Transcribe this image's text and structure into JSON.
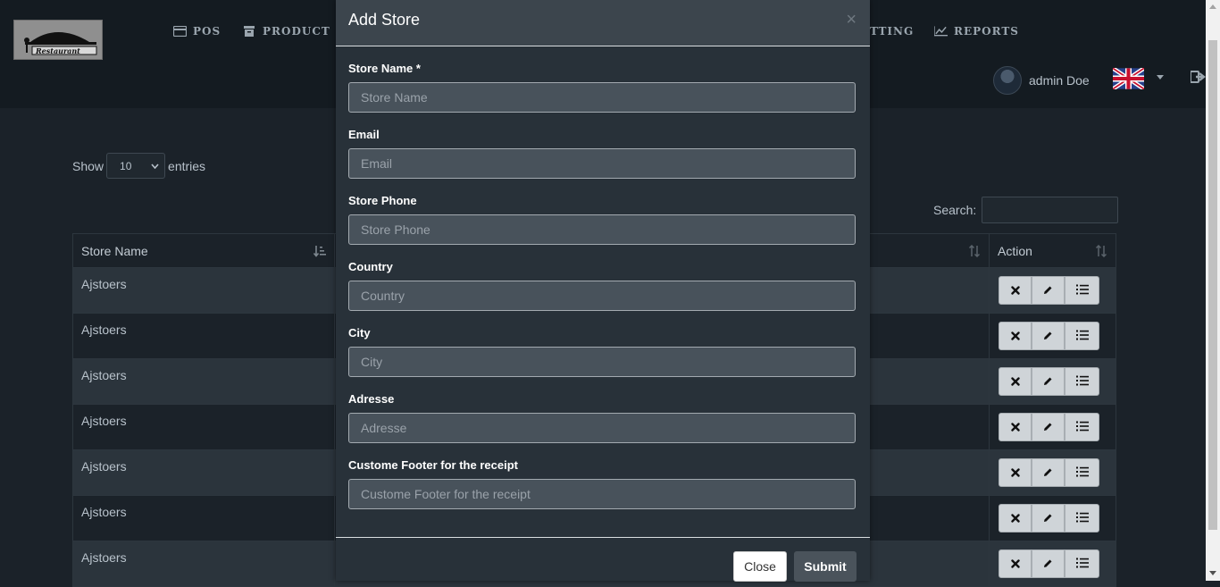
{
  "nav": {
    "items": [
      {
        "label": "POS",
        "icon": "credit-card-icon"
      },
      {
        "label": "PRODUCT",
        "icon": "archive-icon"
      },
      {
        "label": "TTING",
        "icon": "settings-icon"
      },
      {
        "label": "REPORTS",
        "icon": "line-chart-icon"
      }
    ],
    "user_name": "admin Doe",
    "language_flag": "uk-flag-icon"
  },
  "table": {
    "show_label": "Show",
    "entries_value": "10",
    "entries_label": "entries",
    "search_label": "Search:",
    "headers": [
      "Store Name",
      "Action"
    ],
    "rows": [
      "Ajstoers",
      "Ajstoers",
      "Ajstoers",
      "Ajstoers",
      "Ajstoers",
      "Ajstoers",
      "Ajstoers"
    ]
  },
  "modal": {
    "title": "Add Store",
    "close_x": "×",
    "fields": [
      {
        "label": "Store Name *",
        "placeholder": "Store Name"
      },
      {
        "label": "Email",
        "placeholder": "Email"
      },
      {
        "label": "Store Phone",
        "placeholder": "Store Phone"
      },
      {
        "label": "Country",
        "placeholder": "Country"
      },
      {
        "label": "City",
        "placeholder": "City"
      },
      {
        "label": "Adresse",
        "placeholder": "Adresse"
      },
      {
        "label": "Custome Footer for the receipt",
        "placeholder": "Custome Footer for the receipt"
      }
    ],
    "close_button": "Close",
    "submit_button": "Submit"
  },
  "colors": {
    "page_bg": "#1b2229",
    "navbar_bg": "#141b21",
    "modal_bg": "#283139",
    "modal_header_bg": "#3c454d",
    "input_bg": "#48525b"
  }
}
